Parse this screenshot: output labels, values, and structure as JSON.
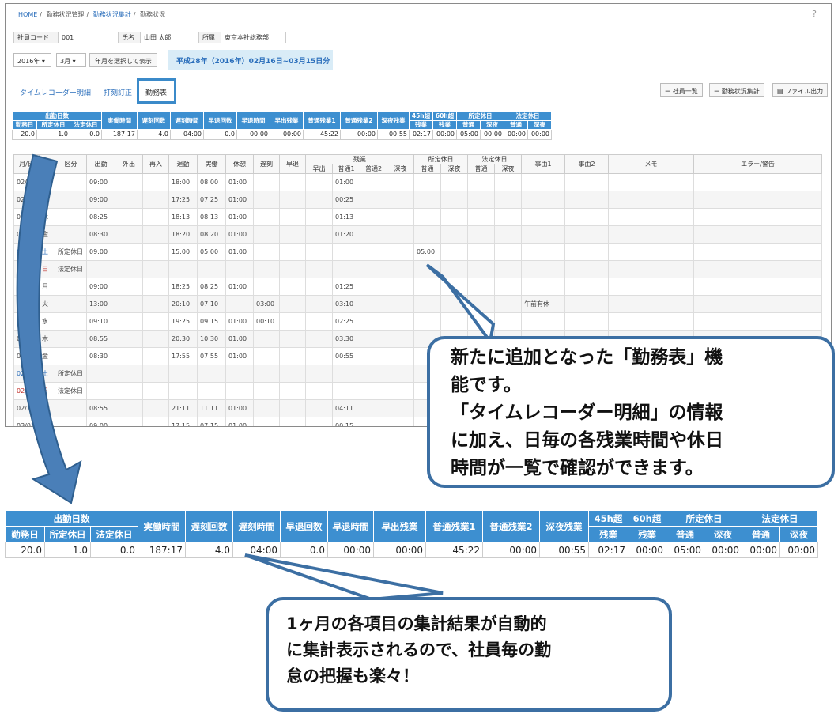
{
  "breadcrumb": {
    "home": "HOME",
    "sep": "/",
    "level1": "勤務状況管理",
    "level2": "勤務状況集計",
    "current": "勤務状況"
  },
  "help_label": "?",
  "employee": {
    "code_label": "社員コード",
    "code": "001",
    "name_label": "氏名",
    "name": "山田 太郎",
    "dept_label": "所属",
    "dept": "東京本社総務部"
  },
  "filter": {
    "year": "2016年",
    "month": "3月",
    "show_button": "年月を選択して表示",
    "period": "平成28年（2016年）02月16日~03月15日分"
  },
  "tabs": [
    {
      "label": "タイムレコーダー明細"
    },
    {
      "label": "打刻訂正"
    },
    {
      "label": "勤務表"
    }
  ],
  "toolbar": {
    "employee_list": "社員一覧",
    "summary": "勤務状況集計",
    "file_output": "ファイル出力"
  },
  "summary": {
    "group_days": "出勤日数",
    "group_scheduled_holiday": "所定休日",
    "group_legal_holiday": "法定休日",
    "headers": [
      "勤務日",
      "所定休日",
      "法定休日",
      "実働時間",
      "遅刻回数",
      "遅刻時間",
      "早退回数",
      "早退時間",
      "早出残業",
      "普通残業1",
      "普通残業2",
      "深夜残業",
      "45h超",
      "残業",
      "60h超",
      "残業",
      "普通",
      "深夜",
      "普通",
      "深夜"
    ],
    "values": [
      "20.0",
      "1.0",
      "0.0",
      "187:17",
      "4.0",
      "04:00",
      "0.0",
      "00:00",
      "00:00",
      "45:22",
      "00:00",
      "00:55",
      "02:17",
      "00:00",
      "05:00",
      "00:00",
      "00:00",
      "00:00"
    ]
  },
  "detail": {
    "headers": {
      "date": "月/日",
      "dow": "曜",
      "kubun": "区分",
      "in": "出勤",
      "out_go": "外出",
      "re_in": "再入",
      "leave": "退勤",
      "actual": "実働",
      "rest": "休憩",
      "late": "遅刻",
      "early": "早退",
      "overtime": "残業",
      "ot_early": "早出",
      "ot_normal1": "普通1",
      "ot_normal2": "普通2",
      "ot_night": "深夜",
      "sched_hol": "所定休日",
      "legal_hol": "法定休日",
      "normal": "普通",
      "night": "深夜",
      "reason1": "事由1",
      "reason2": "事由2",
      "memo": "メモ",
      "error": "エラー/警告"
    },
    "rows": [
      {
        "date": "02/16",
        "dow": "火",
        "kubun": "",
        "in": "09:00",
        "leave": "18:00",
        "actual": "08:00",
        "rest": "01:00",
        "late": "",
        "ot1": "01:00",
        "sched": "",
        "reason1": "",
        "color": ""
      },
      {
        "date": "02/17",
        "dow": "水",
        "kubun": "",
        "in": "09:00",
        "leave": "17:25",
        "actual": "07:25",
        "rest": "01:00",
        "late": "",
        "ot1": "00:25",
        "sched": "",
        "reason1": "",
        "color": ""
      },
      {
        "date": "02/18",
        "dow": "木",
        "kubun": "",
        "in": "08:25",
        "leave": "18:13",
        "actual": "08:13",
        "rest": "01:00",
        "late": "",
        "ot1": "01:13",
        "sched": "",
        "reason1": "",
        "color": ""
      },
      {
        "date": "02/19",
        "dow": "金",
        "kubun": "",
        "in": "08:30",
        "leave": "18:20",
        "actual": "08:20",
        "rest": "01:00",
        "late": "",
        "ot1": "01:20",
        "sched": "",
        "reason1": "",
        "color": ""
      },
      {
        "date": "02/20",
        "dow": "土",
        "kubun": "所定休日",
        "in": "09:00",
        "leave": "15:00",
        "actual": "05:00",
        "rest": "01:00",
        "late": "",
        "ot1": "",
        "sched": "05:00",
        "reason1": "",
        "color": "blue"
      },
      {
        "date": "02/21",
        "dow": "日",
        "kubun": "法定休日",
        "in": "",
        "leave": "",
        "actual": "",
        "rest": "",
        "late": "",
        "ot1": "",
        "sched": "",
        "reason1": "",
        "color": "red"
      },
      {
        "date": "02/22",
        "dow": "月",
        "kubun": "",
        "in": "09:00",
        "leave": "18:25",
        "actual": "08:25",
        "rest": "01:00",
        "late": "",
        "ot1": "01:25",
        "sched": "",
        "reason1": "",
        "color": ""
      },
      {
        "date": "02/23",
        "dow": "火",
        "kubun": "",
        "in": "13:00",
        "leave": "20:10",
        "actual": "07:10",
        "rest": "",
        "late": "03:00",
        "ot1": "03:10",
        "sched": "",
        "reason1": "午前有休",
        "color": ""
      },
      {
        "date": "02/24",
        "dow": "水",
        "kubun": "",
        "in": "09:10",
        "leave": "19:25",
        "actual": "09:15",
        "rest": "01:00",
        "late": "00:10",
        "ot1": "02:25",
        "sched": "",
        "reason1": "",
        "color": ""
      },
      {
        "date": "02/25",
        "dow": "木",
        "kubun": "",
        "in": "08:55",
        "leave": "20:30",
        "actual": "10:30",
        "rest": "01:00",
        "late": "",
        "ot1": "03:30",
        "sched": "",
        "reason1": "",
        "color": ""
      },
      {
        "date": "02/26",
        "dow": "金",
        "kubun": "",
        "in": "08:30",
        "leave": "17:55",
        "actual": "07:55",
        "rest": "01:00",
        "late": "",
        "ot1": "00:55",
        "sched": "",
        "reason1": "",
        "color": ""
      },
      {
        "date": "02/27",
        "dow": "土",
        "kubun": "所定休日",
        "in": "",
        "leave": "",
        "actual": "",
        "rest": "",
        "late": "",
        "ot1": "",
        "sched": "",
        "reason1": "",
        "color": "blue"
      },
      {
        "date": "02/28",
        "dow": "日",
        "kubun": "法定休日",
        "in": "",
        "leave": "",
        "actual": "",
        "rest": "",
        "late": "",
        "ot1": "",
        "sched": "",
        "reason1": "",
        "color": "red"
      },
      {
        "date": "02/29",
        "dow": "月",
        "kubun": "",
        "in": "08:55",
        "leave": "21:11",
        "actual": "11:11",
        "rest": "01:00",
        "late": "",
        "ot1": "04:11",
        "sched": "",
        "reason1": "",
        "color": ""
      },
      {
        "date": "03/01",
        "dow": "火",
        "kubun": "",
        "in": "09:00",
        "leave": "17:15",
        "actual": "07:15",
        "rest": "01:00",
        "late": "",
        "ot1": "00:15",
        "sched": "",
        "reason1": "",
        "color": ""
      }
    ]
  },
  "callout1": {
    "lines": [
      "新たに追加となった「勤務表」機",
      "能です。",
      "「タイムレコーダー明細」の情報",
      "に加え、日毎の各残業時間や休日",
      "時間が一覧で確認ができます。"
    ]
  },
  "callout2": {
    "lines": [
      "1ヶ月の各項目の集計結果が自動的",
      "に集計表示されるので、社員毎の勤",
      "怠の把握も楽々！"
    ]
  },
  "colors": {
    "header_blue": "#3d8fd0",
    "callout_border": "#3c6fa3",
    "arrow": "#4a7fb8"
  }
}
